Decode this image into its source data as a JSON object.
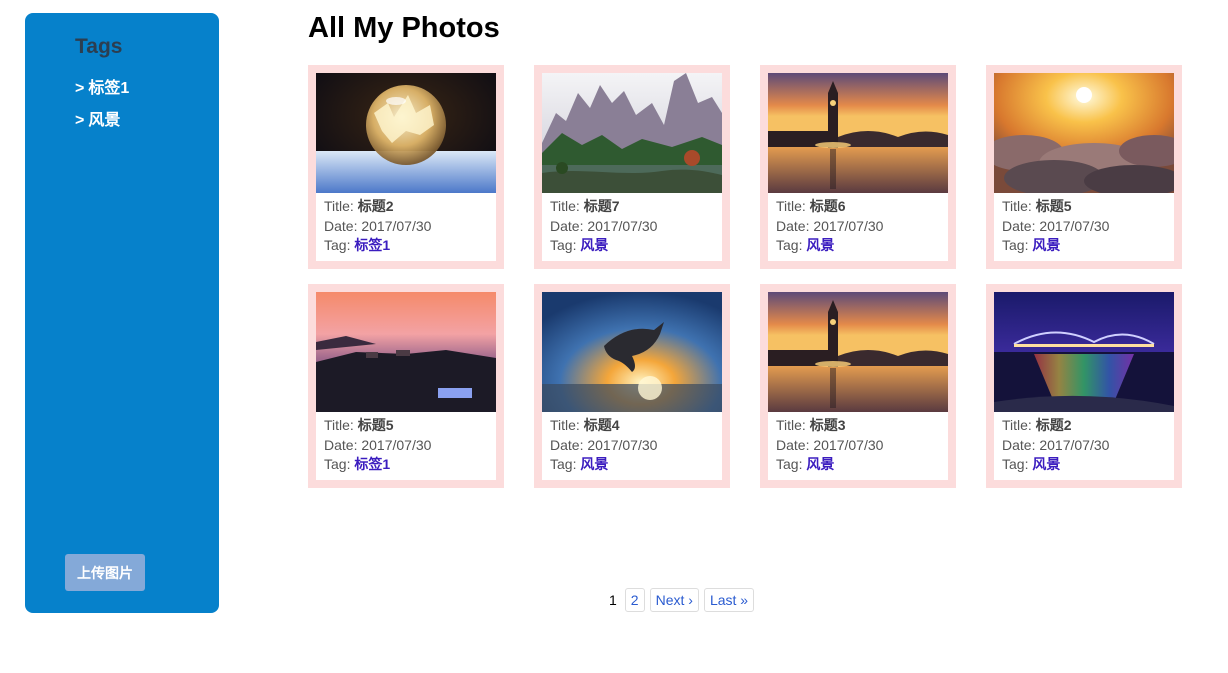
{
  "sidebar": {
    "title": "Tags",
    "tags": [
      {
        "label": "标签1"
      },
      {
        "label": "风景"
      }
    ],
    "chevron": ">",
    "upload_label": "上传图片"
  },
  "main": {
    "title": "All My Photos",
    "labels": {
      "title": "Title: ",
      "date": "Date: ",
      "tag": "Tag: "
    },
    "photos": [
      {
        "title": "标题2",
        "date": "2017/07/30",
        "tag": "标签1",
        "image": "frozen-bubble"
      },
      {
        "title": "标题7",
        "date": "2017/07/30",
        "tag": "风景",
        "image": "mountain-lake"
      },
      {
        "title": "标题6",
        "date": "2017/07/30",
        "tag": "风景",
        "image": "big-ben-sunset"
      },
      {
        "title": "标题5",
        "date": "2017/07/30",
        "tag": "风景",
        "image": "sunset-clouds"
      },
      {
        "title": "标题5",
        "date": "2017/07/30",
        "tag": "标签1",
        "image": "coastal-sunset"
      },
      {
        "title": "标题4",
        "date": "2017/07/30",
        "tag": "风景",
        "image": "dolphin-jump"
      },
      {
        "title": "标题3",
        "date": "2017/07/30",
        "tag": "风景",
        "image": "big-ben-sunset"
      },
      {
        "title": "标题2",
        "date": "2017/07/30",
        "tag": "风景",
        "image": "rainbow-bridge"
      }
    ]
  },
  "pagination": {
    "current": "1",
    "pages": [
      "2"
    ],
    "next": "Next ›",
    "last": "Last »"
  },
  "colors": {
    "sidebar_bg": "#0681cb",
    "card_border": "#fcdcdc",
    "tag_link": "#3b1dbf",
    "upload_button": "#84a9d8"
  }
}
